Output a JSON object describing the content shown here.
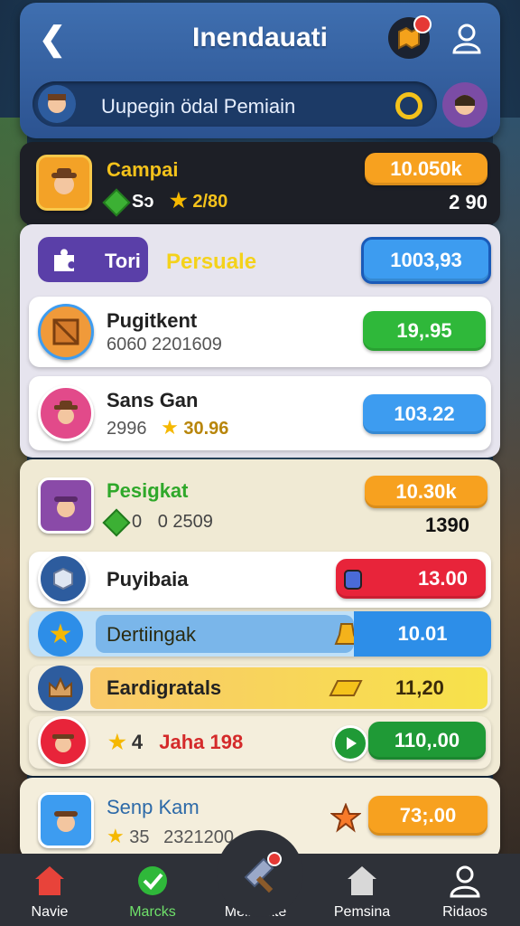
{
  "header": {
    "title": "Inendauati",
    "search_text": "Uupegin ödal Pemiain"
  },
  "featured": {
    "name": "Campai",
    "gems": "Sɔ",
    "stars": "2/80",
    "pill": "10.050k",
    "value": "2 90"
  },
  "section1": {
    "tab_label": "Tori",
    "tab_title": "Persuale",
    "tab_value": "1003,93",
    "rows": [
      {
        "name": "Pugitkent",
        "sub": "6060 2201609",
        "pill": "19,.95",
        "color": "#2fb83a"
      },
      {
        "name": "Sans Gan",
        "sub": "2996",
        "stars": "30.96",
        "pill": "103.22",
        "color": "#3d9cf0"
      }
    ]
  },
  "section2": {
    "name": "Pesigkat",
    "gems": "0",
    "sub": "0 2509",
    "pill": "10.30k",
    "value": "1390",
    "rows": [
      {
        "name": "Puyibaia",
        "pill": "13.00",
        "color": "#e8243a"
      },
      {
        "name": "Dertiingak",
        "pill": "10.01",
        "color": "#2d8ee8"
      },
      {
        "name": "Eardigratals",
        "pill": "11,20",
        "color": "#f4d93a"
      },
      {
        "stars": "4",
        "name": "Jaha 198",
        "pill": "110,.00",
        "color": "#1f9a36"
      }
    ]
  },
  "bottom_card": {
    "name": "Senp Kam",
    "stars": "35",
    "sub": "2321200",
    "pill": "73;.00"
  },
  "nav": [
    {
      "label": "Navie"
    },
    {
      "label": "Marcks"
    },
    {
      "label": "Meinlukte"
    },
    {
      "label": "Pemsina"
    },
    {
      "label": "Ridaos"
    }
  ],
  "colors": {
    "header_blue": "#2c5391",
    "orange": "#f7a11f",
    "green": "#2fb83a",
    "blue": "#3d9cf0",
    "red": "#e8243a",
    "purple": "#5a3fa8"
  }
}
